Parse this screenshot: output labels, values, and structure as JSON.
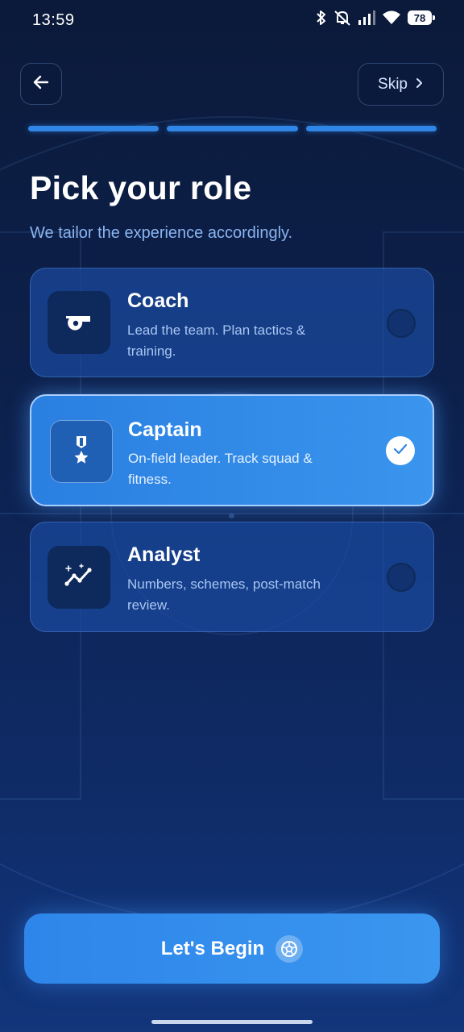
{
  "status_bar": {
    "time": "13:59",
    "battery": "78",
    "icons": [
      "bluetooth-icon",
      "mute-icon",
      "signal-icon",
      "wifi-icon",
      "battery-icon"
    ]
  },
  "nav": {
    "back_icon": "arrow-left-icon",
    "skip_label": "Skip",
    "skip_icon": "chevron-right-icon"
  },
  "progress": {
    "steps_total": 3,
    "steps_complete": 3
  },
  "header": {
    "title": "Pick your role",
    "subtitle": "We tailor the experience accordingly."
  },
  "roles": [
    {
      "title": "Coach",
      "description": "Lead the team. Plan tactics & training.",
      "icon": "whistle-icon",
      "selected": false
    },
    {
      "title": "Captain",
      "description": "On-field leader. Track squad & fitness.",
      "icon": "medal-icon",
      "selected": true
    },
    {
      "title": "Analyst",
      "description": "Numbers, schemes, post-match review.",
      "icon": "chart-line-icon",
      "selected": false
    }
  ],
  "cta": {
    "label": "Let's Begin",
    "icon": "soccer-ball-icon"
  },
  "colors": {
    "background": "#0d2250",
    "accent": "#2f86e6",
    "selected_card": "#3a95ee",
    "subtitle": "#8ab4f0"
  }
}
